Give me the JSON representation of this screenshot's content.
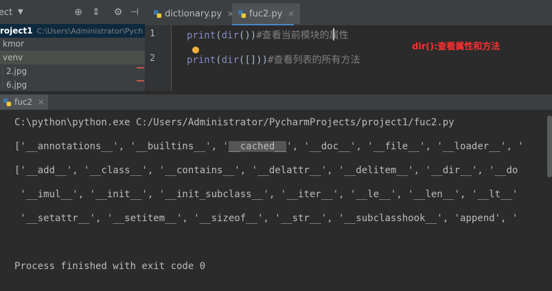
{
  "project": {
    "title": "ect",
    "root_name": "roject1",
    "root_path": "C:\\Users\\Administrator\\Pych",
    "items": [
      "kmor",
      "venv",
      "2.jpg",
      "6.jpg"
    ]
  },
  "tabs": [
    {
      "label": "dictionary.py"
    },
    {
      "label": "fuc2.py"
    }
  ],
  "editor": {
    "lines": [
      {
        "no": "1",
        "kw": "print",
        "open": "(",
        "kw2": "dir",
        "rest": "())",
        "comment": "#查看当前模块的属性"
      },
      {
        "no": "2",
        "kw": "print",
        "open": "(",
        "kw2": "dir",
        "rest": "([]))",
        "comment": "#查看列表的所有方法"
      }
    ],
    "annotation": "dir():查看属性和方法"
  },
  "run": {
    "tab_label": "fuc2",
    "lines": [
      "C:\\python\\python.exe C:/Users/Administrator/PycharmProjects/project1/fuc2.py",
      "['__annotations__', '__builtins__', '",
      "__cached__",
      "', '__doc__', '__file__', '__loader__', '",
      "['__add__', '__class__', '__contains__', '__delattr__', '__delitem__', '__dir__', '__do",
      " '__imul__', '__init__', '__init_subclass__', '__iter__', '__le__', '__len__', '__lt__'",
      " '__setattr__', '__setitem__', '__sizeof__', '__str__', '__subclasshook__', 'append', '",
      "Process finished with exit code 0"
    ]
  },
  "colors": {
    "background": "#2b2b2b",
    "keyword": "#8888c6",
    "comment": "#808080",
    "annotation": "#ff3030",
    "tab_underline": "#4a88c7"
  }
}
